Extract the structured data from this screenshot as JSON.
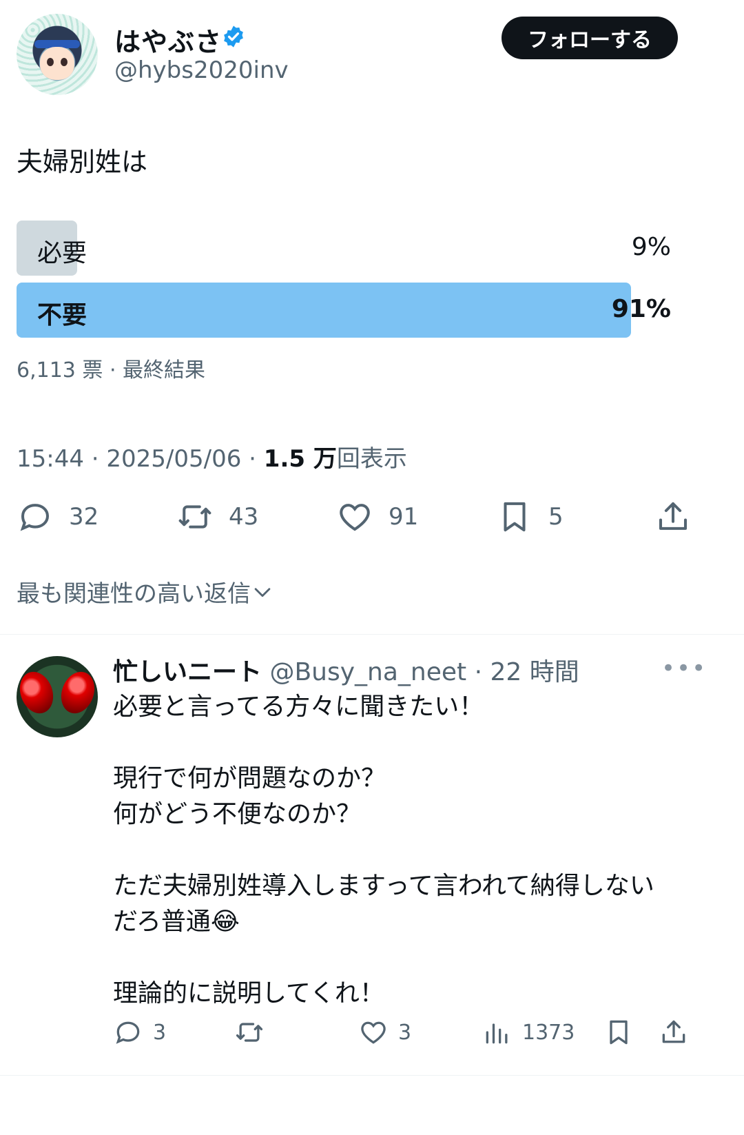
{
  "author": {
    "name": "はやぶさ",
    "handle": "@hybs2020inv",
    "follow_label": "フォローする"
  },
  "tweet": {
    "text": "夫婦別姓は",
    "poll": {
      "options": [
        {
          "label": "必要",
          "percent_text": "9%",
          "percent": 9,
          "color": "#cfd9de"
        },
        {
          "label": "不要",
          "percent_text": "91%",
          "percent": 91,
          "color": "#7cc2f3"
        }
      ],
      "meta": "6,113 票 · 最終結果"
    },
    "time": "15:44 · 2025/05/06 · ",
    "views_count": "1.5 万",
    "views_label": "回表示",
    "stats": {
      "replies": "32",
      "retweets": "43",
      "likes": "91",
      "bookmarks": "5"
    }
  },
  "replies_filter": "最も関連性の高い返信",
  "reply": {
    "name": "忙しいニート",
    "meta": " @Busy_na_neet · 22 時間",
    "lines": [
      "必要と言ってる方々に聞きたい！",
      "",
      "現行で何が問題なのか？",
      "何がどう不便なのか？",
      "",
      "ただ夫婦別姓導入しますって言われて納得しない",
      "だろ普通😂",
      "",
      "理論的に説明してくれ！"
    ],
    "stats": {
      "replies": "3",
      "likes": "3",
      "views": "1373"
    }
  },
  "colors": {
    "verified": "#1d9bf0",
    "muted": "#536471"
  },
  "icons": [
    "verified-badge-icon",
    "reply-icon",
    "retweet-icon",
    "like-icon",
    "bookmark-icon",
    "share-icon",
    "views-icon",
    "chevron-down-icon",
    "more-icon"
  ]
}
